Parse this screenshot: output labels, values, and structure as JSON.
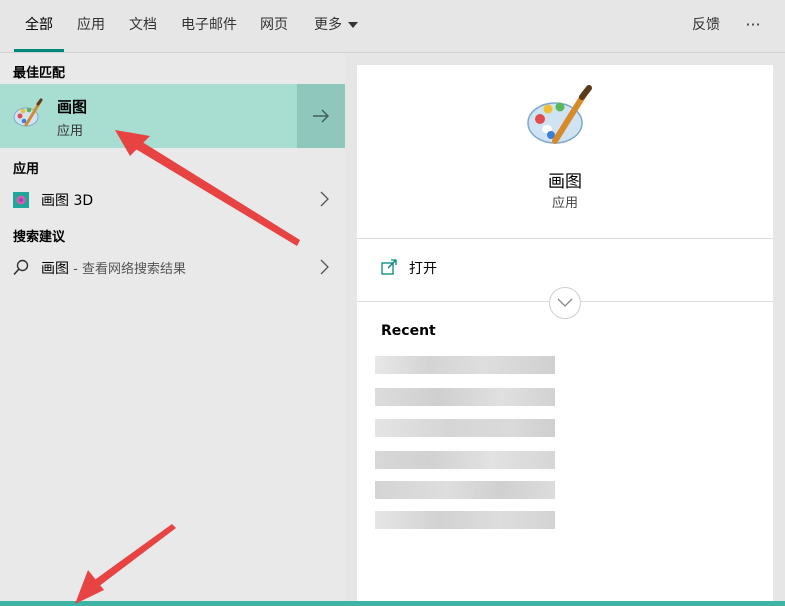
{
  "tabs": [
    {
      "label": "全部",
      "active": true
    },
    {
      "label": "应用"
    },
    {
      "label": "文档"
    },
    {
      "label": "电子邮件"
    },
    {
      "label": "网页"
    },
    {
      "label": "更多"
    }
  ],
  "topbar_right": {
    "feedback": "反馈",
    "more": "···"
  },
  "left": {
    "best_match_header": "最佳匹配",
    "best_match": {
      "title": "画图",
      "subtitle": "应用"
    },
    "apps_header": "应用",
    "app_item": {
      "label": "画图 3D"
    },
    "search_header": "搜索建议",
    "search_item": {
      "term": "画图",
      "suffix": " - 查看网络搜索结果"
    }
  },
  "right": {
    "app_title": "画图",
    "app_subtitle": "应用",
    "open_label": "打开",
    "recent_label": "Recent"
  },
  "colors": {
    "accent": "#00897b",
    "selection": "#a8ddd2",
    "annotation": "#e84343"
  },
  "icons": [
    "paint-palette-icon",
    "arrow-right-icon",
    "paint3d-icon",
    "chevron-right-icon",
    "search-icon",
    "open-icon",
    "chevron-down-icon"
  ]
}
